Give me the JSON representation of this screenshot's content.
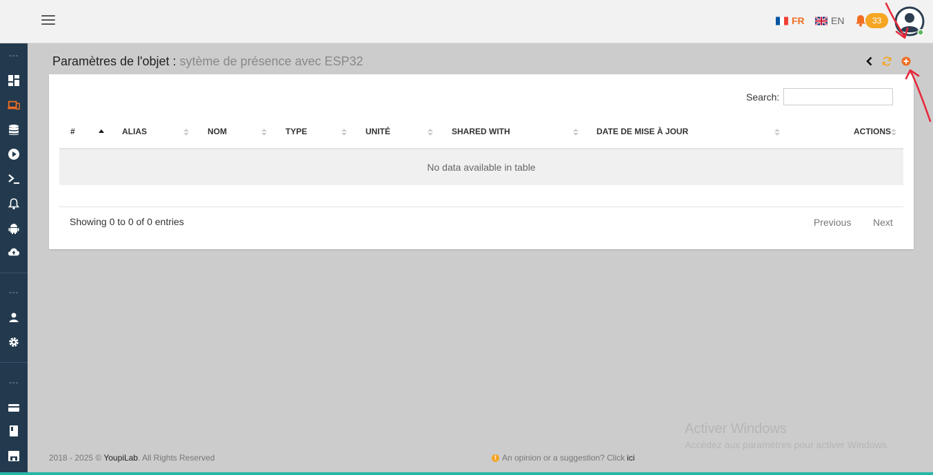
{
  "topbar": {
    "lang_fr": "FR",
    "lang_en": "EN",
    "notifications_count": "33",
    "accent_color": "#f26d21"
  },
  "sidebar": {
    "section_dots": "---",
    "icons": [
      "dashboard-icon",
      "devices-icon",
      "database-icon",
      "play-icon",
      "terminal-icon",
      "bell-icon",
      "android-icon",
      "cloud-upload-icon",
      "user-icon",
      "gear-icon",
      "card-icon",
      "book-icon",
      "save-icon"
    ]
  },
  "page": {
    "title": "Paramètres de l'objet :",
    "subtitle": "sytème de présence avec ESP32"
  },
  "table": {
    "search_label": "Search:",
    "search_value": "",
    "columns": [
      "#",
      "ALIAS",
      "NOM",
      "TYPE",
      "UNITÉ",
      "SHARED WITH",
      "DATE DE MISE À JOUR",
      "ACTIONS"
    ],
    "empty_message": "No data available in table",
    "info": "Showing 0 to 0 of 0 entries",
    "prev_label": "Previous",
    "next_label": "Next"
  },
  "footer": {
    "copyright_prefix": "2018 - 2025 ©",
    "brand": "YoupiLab",
    "copyright_suffix": ". All Rights Reserved",
    "suggestion_text": "An opinion or a suggestion? Click",
    "suggestion_link": "ici"
  },
  "watermark": {
    "line1": "Activer Windows",
    "line2": "Accédez aux paramètres pour activer Windows."
  }
}
